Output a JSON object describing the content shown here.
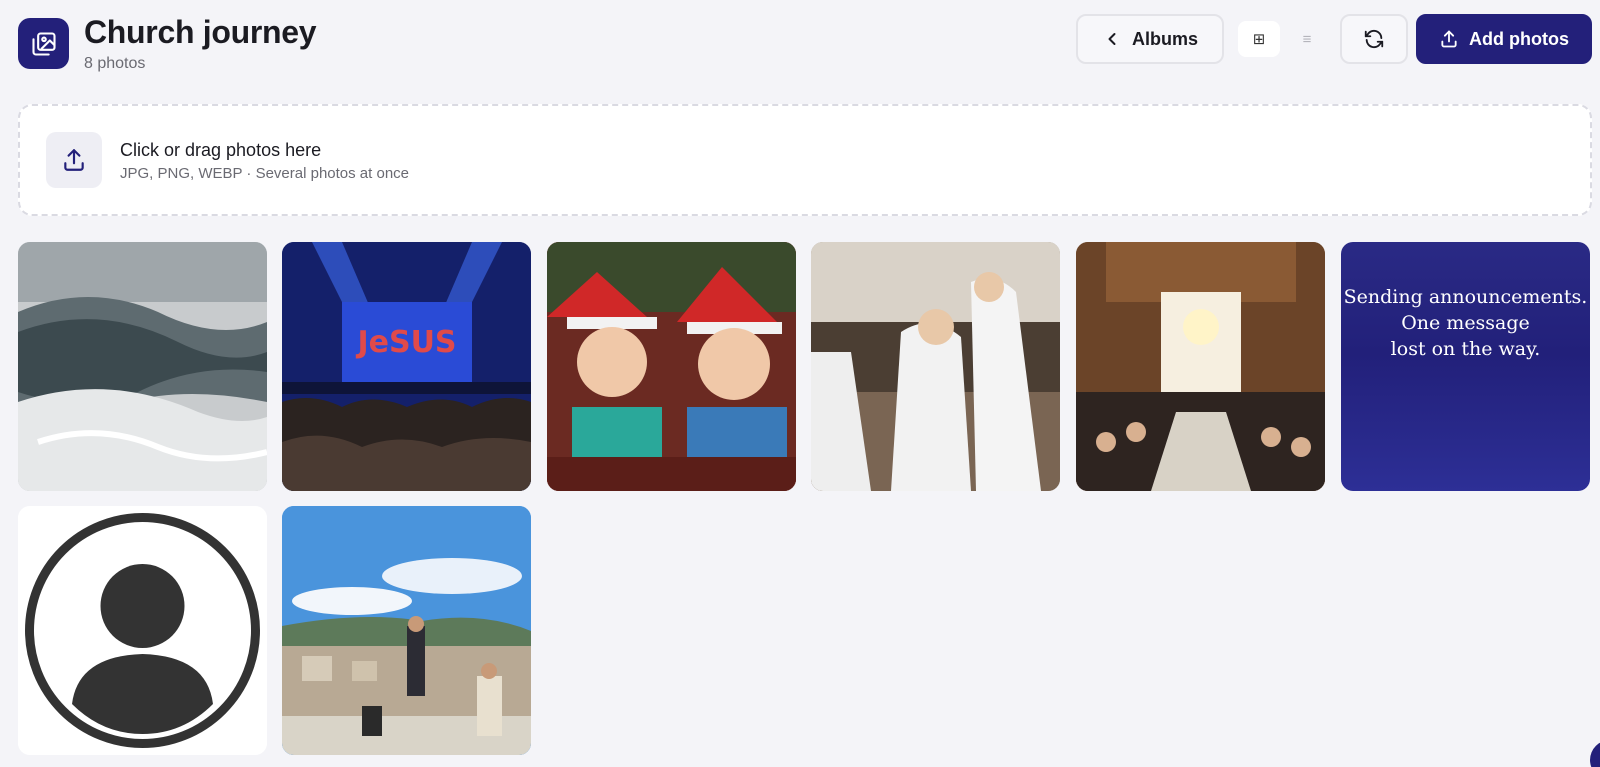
{
  "header": {
    "app_icon": "photo-album-icon",
    "title": "Church journey",
    "photo_count": "8 photos",
    "albums_label": "Albums",
    "view_grid_icon": "⊞",
    "view_list_icon": "≡",
    "add_photos_label": "Add photos"
  },
  "dropzone": {
    "title": "Click or drag photos here",
    "subtitle": "JPG, PNG, WEBP · Several photos at once"
  },
  "photos": [
    {
      "subject": "ocean-wave"
    },
    {
      "subject": "concert"
    },
    {
      "subject": "kids-santa-hats"
    },
    {
      "subject": "procession"
    },
    {
      "subject": "church-interior"
    },
    {
      "subject": "text-card",
      "caption_lines": [
        "Sending announcements.",
        "One message",
        "lost on the way."
      ]
    },
    {
      "subject": "avatar-placeholder"
    },
    {
      "subject": "city-view"
    }
  ],
  "colors": {
    "accent": "#23207a",
    "background": "#f4f4f8"
  }
}
